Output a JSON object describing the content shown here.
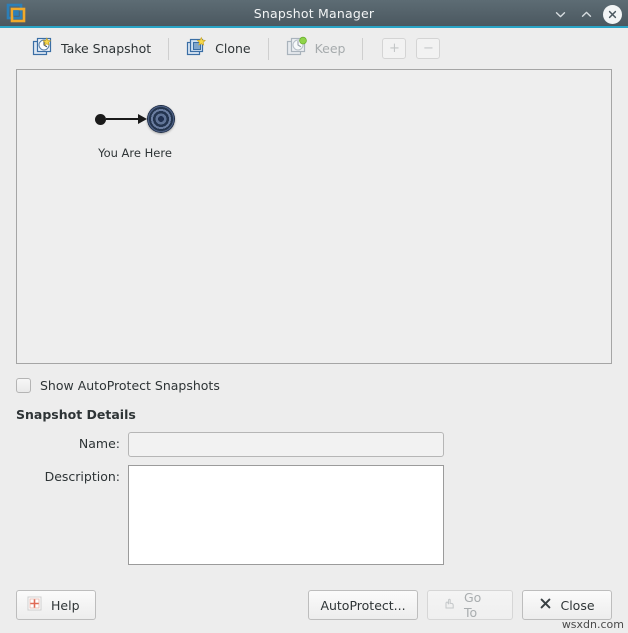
{
  "window": {
    "title": "Snapshot Manager",
    "app_icon": "vmware-logo-icon",
    "controls": {
      "minimize": "chevron-down-icon",
      "maximize": "chevron-up-icon",
      "close": "close-icon"
    }
  },
  "toolbar": {
    "items": [
      {
        "label": "Take Snapshot",
        "icon": "take-snapshot-icon",
        "enabled": true
      },
      {
        "label": "Clone",
        "icon": "clone-icon",
        "enabled": true
      },
      {
        "label": "Keep",
        "icon": "keep-icon",
        "enabled": false
      }
    ],
    "zoom_in": "+",
    "zoom_out": "−"
  },
  "tree": {
    "node_label": "You Are Here",
    "node_icon": "you-are-here-target-icon"
  },
  "options": {
    "show_autoprotect_label": "Show AutoProtect Snapshots",
    "show_autoprotect_checked": false
  },
  "details": {
    "section_title": "Snapshot Details",
    "name_label": "Name:",
    "name_value": "",
    "name_placeholder": "",
    "description_label": "Description:",
    "description_value": "",
    "description_placeholder": ""
  },
  "footer": {
    "help_label": "Help",
    "help_icon": "help-icon",
    "autoprotect_label": "AutoProtect...",
    "goto_label": "Go To",
    "goto_icon": "goto-icon",
    "goto_enabled": false,
    "close_label": "Close",
    "close_icon": "x-icon"
  },
  "watermark": "wsxdn.com",
  "colors": {
    "titlebar_top": "#5d6c74",
    "titlebar_bottom": "#4b5860",
    "accent_underline": "#2aa5c7",
    "window_bg": "#ededed",
    "panel_bg": "#eeeeee",
    "panel_border": "#a5a5a5",
    "target_navy": "#23344f"
  }
}
